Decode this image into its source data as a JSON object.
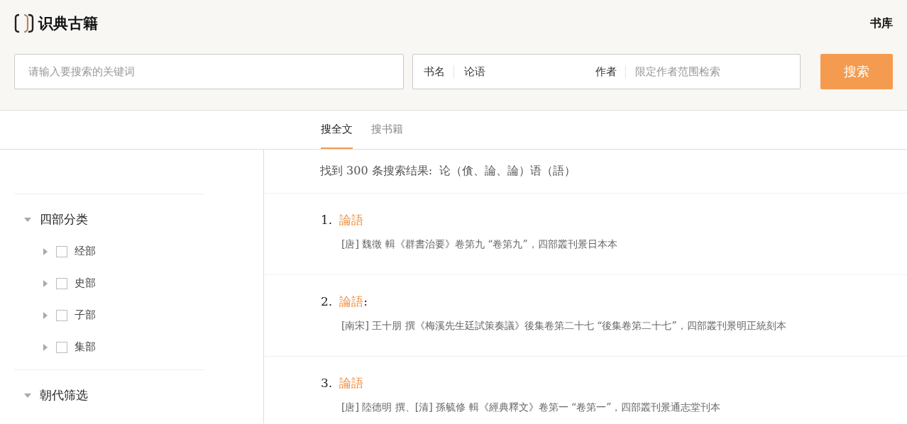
{
  "logo": {
    "text": "识典古籍"
  },
  "nav": {
    "library": "书库"
  },
  "search": {
    "keyword_placeholder": "请输入要搜索的关键词",
    "book_label": "书名",
    "book_value": "论语",
    "author_label": "作者",
    "author_placeholder": "限定作者范围检索",
    "button": "搜索"
  },
  "tabs": [
    {
      "label": "搜全文",
      "selected": true
    },
    {
      "label": "搜书籍",
      "selected": false
    }
  ],
  "filters": [
    {
      "title": "四部分类",
      "expanded": true,
      "children": [
        {
          "label": "经部",
          "checked": false,
          "expanded": false
        },
        {
          "label": "史部",
          "checked": false,
          "expanded": false
        },
        {
          "label": "子部",
          "checked": false,
          "expanded": false
        },
        {
          "label": "集部",
          "checked": false,
          "expanded": false
        }
      ]
    },
    {
      "title": "朝代筛选",
      "expanded": true
    }
  ],
  "summary": "找到 300 条搜索结果:  论（僋、論、論）语（語）",
  "results": [
    {
      "number": "1.",
      "title": "論語",
      "source": "[唐] 魏徵 輯《群書治要》卷第九 “卷第九”，四部叢刊景日本本"
    },
    {
      "number": "2.",
      "title": "論語",
      "suffix": ":",
      "source": "[南宋] 王十朋 撰《梅溪先生廷試策奏議》後集卷第二十七 “後集卷第二十七”，四部叢刊景明正統刻本"
    },
    {
      "number": "3.",
      "title": "論語",
      "source": "[唐] 陸德明 撰、[清] 孫毓修 輯《經典釋文》卷第一 “卷第一”，四部叢刊景通志堂刊本"
    }
  ]
}
